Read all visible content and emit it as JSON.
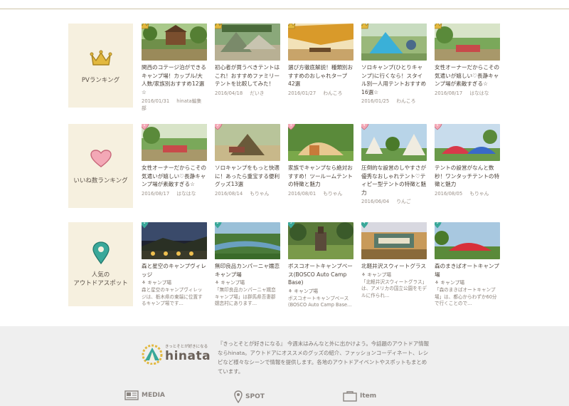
{
  "categories": [
    {
      "label": "PVランキング",
      "icon": "crown-icon",
      "cards": [
        {
          "title": "関西のコテージ泊ができるキャンプ場！カップル/大人数/家族別おすすめ12選☆",
          "date": "2016/01/31",
          "author": "hinata編集部"
        },
        {
          "title": "初心者が買うべきテントはこれ！おすすめファミリーテントを比較してみた！",
          "date": "2016/04/18",
          "author": "だいき"
        },
        {
          "title": "選び方徹底解説！種類別おすすめのおしゃれタープ42選",
          "date": "2016/01/27",
          "author": "わんころ"
        },
        {
          "title": "ソロキャンプ(ひとりキャンプ)に行くなら！スタイル別一人用テントおすすめ16選☆",
          "date": "2016/01/25",
          "author": "わんころ"
        },
        {
          "title": "女性オーナーだからこその気遣いが嬉しい♡長瀞キャンプ場が素敵すぎる☆",
          "date": "2016/08/17",
          "author": "はなはな"
        }
      ]
    },
    {
      "label": "いいね数ランキング",
      "icon": "heart-icon",
      "cards": [
        {
          "title": "女性オーナーだからこその気遣いが嬉しい♡長瀞キャンプ場が素敵すぎる☆",
          "date": "2016/08/17",
          "author": "はなはな"
        },
        {
          "title": "ソロキャンプをもっと快適に！あったら重宝する便利グッズ13選",
          "date": "2016/08/14",
          "author": "もりゃん"
        },
        {
          "title": "家族でキャンプなら絶対おすすめ！ツールームテントの特徴と魅力",
          "date": "2016/08/01",
          "author": "もりゃん"
        },
        {
          "title": "圧倒的な設営のしやすさが優秀なおしゃれテント♡ティピー型テントの特徴と魅力",
          "date": "2016/06/04",
          "author": "りんご"
        },
        {
          "title": "テントの設営がなんと数秒！ワンタッチテントの特徴と魅力",
          "date": "2016/08/05",
          "author": "もりゃん"
        }
      ]
    },
    {
      "label_line1": "人気の",
      "label_line2": "アウトドアスポット",
      "icon": "map-pin-icon",
      "cards": [
        {
          "title": "森と星空のキャンプヴィレッジ",
          "tag": "キャンプ場",
          "desc": "森と星空のキャンプヴィレッジは、栃木県の東端に位置するキャンプ場です..."
        },
        {
          "title": "無印良品カンパーニャ嬬恋キャンプ場",
          "tag": "キャンプ場",
          "desc": "「無印良品カンパーニャ嬬恋キャンプ場」は群馬県吾妻郡嬬恋村にあります..."
        },
        {
          "title": "ボスコオートキャンプベース(BOSCO Auto Camp Base)",
          "tag": "キャンプ場",
          "desc": "ボスコオートキャンプベース(BOSCO Auto Camp Base..."
        },
        {
          "title": "北軽井沢スウィートグラス",
          "tag": "キャンプ場",
          "desc": "「北軽井沢スウィートグラス」は、アメリカの国立公園をモデルに作られ..."
        },
        {
          "title": "森のまきばオートキャンプ場",
          "tag": "キャンプ場",
          "desc": "「森のまきばオートキャンプ場」は、都心からわずか60分で行くことので..."
        }
      ]
    }
  ],
  "footer": {
    "logo_tagline": "きっとそとが好きになる",
    "logo_word": "hinata",
    "description": "『きっとそとが好きになる』 今週末はみんなと外に出かけよう。今話題のアウトドア情報ならhinata。アウトドアにオススメのグッズの紹介、ファッションコーディネート、レシピなど様々なシーンで情報を提供します。各地のアウトドアイベントやスポットもまとめています。",
    "nav": [
      "MEDIA",
      "SPOT",
      "Item"
    ]
  },
  "colors": {
    "gold": "#e2b83f",
    "pink": "#e58a9a",
    "teal": "#3aa89a",
    "panel": "#f6f0df",
    "footer_bg": "#efefef"
  }
}
